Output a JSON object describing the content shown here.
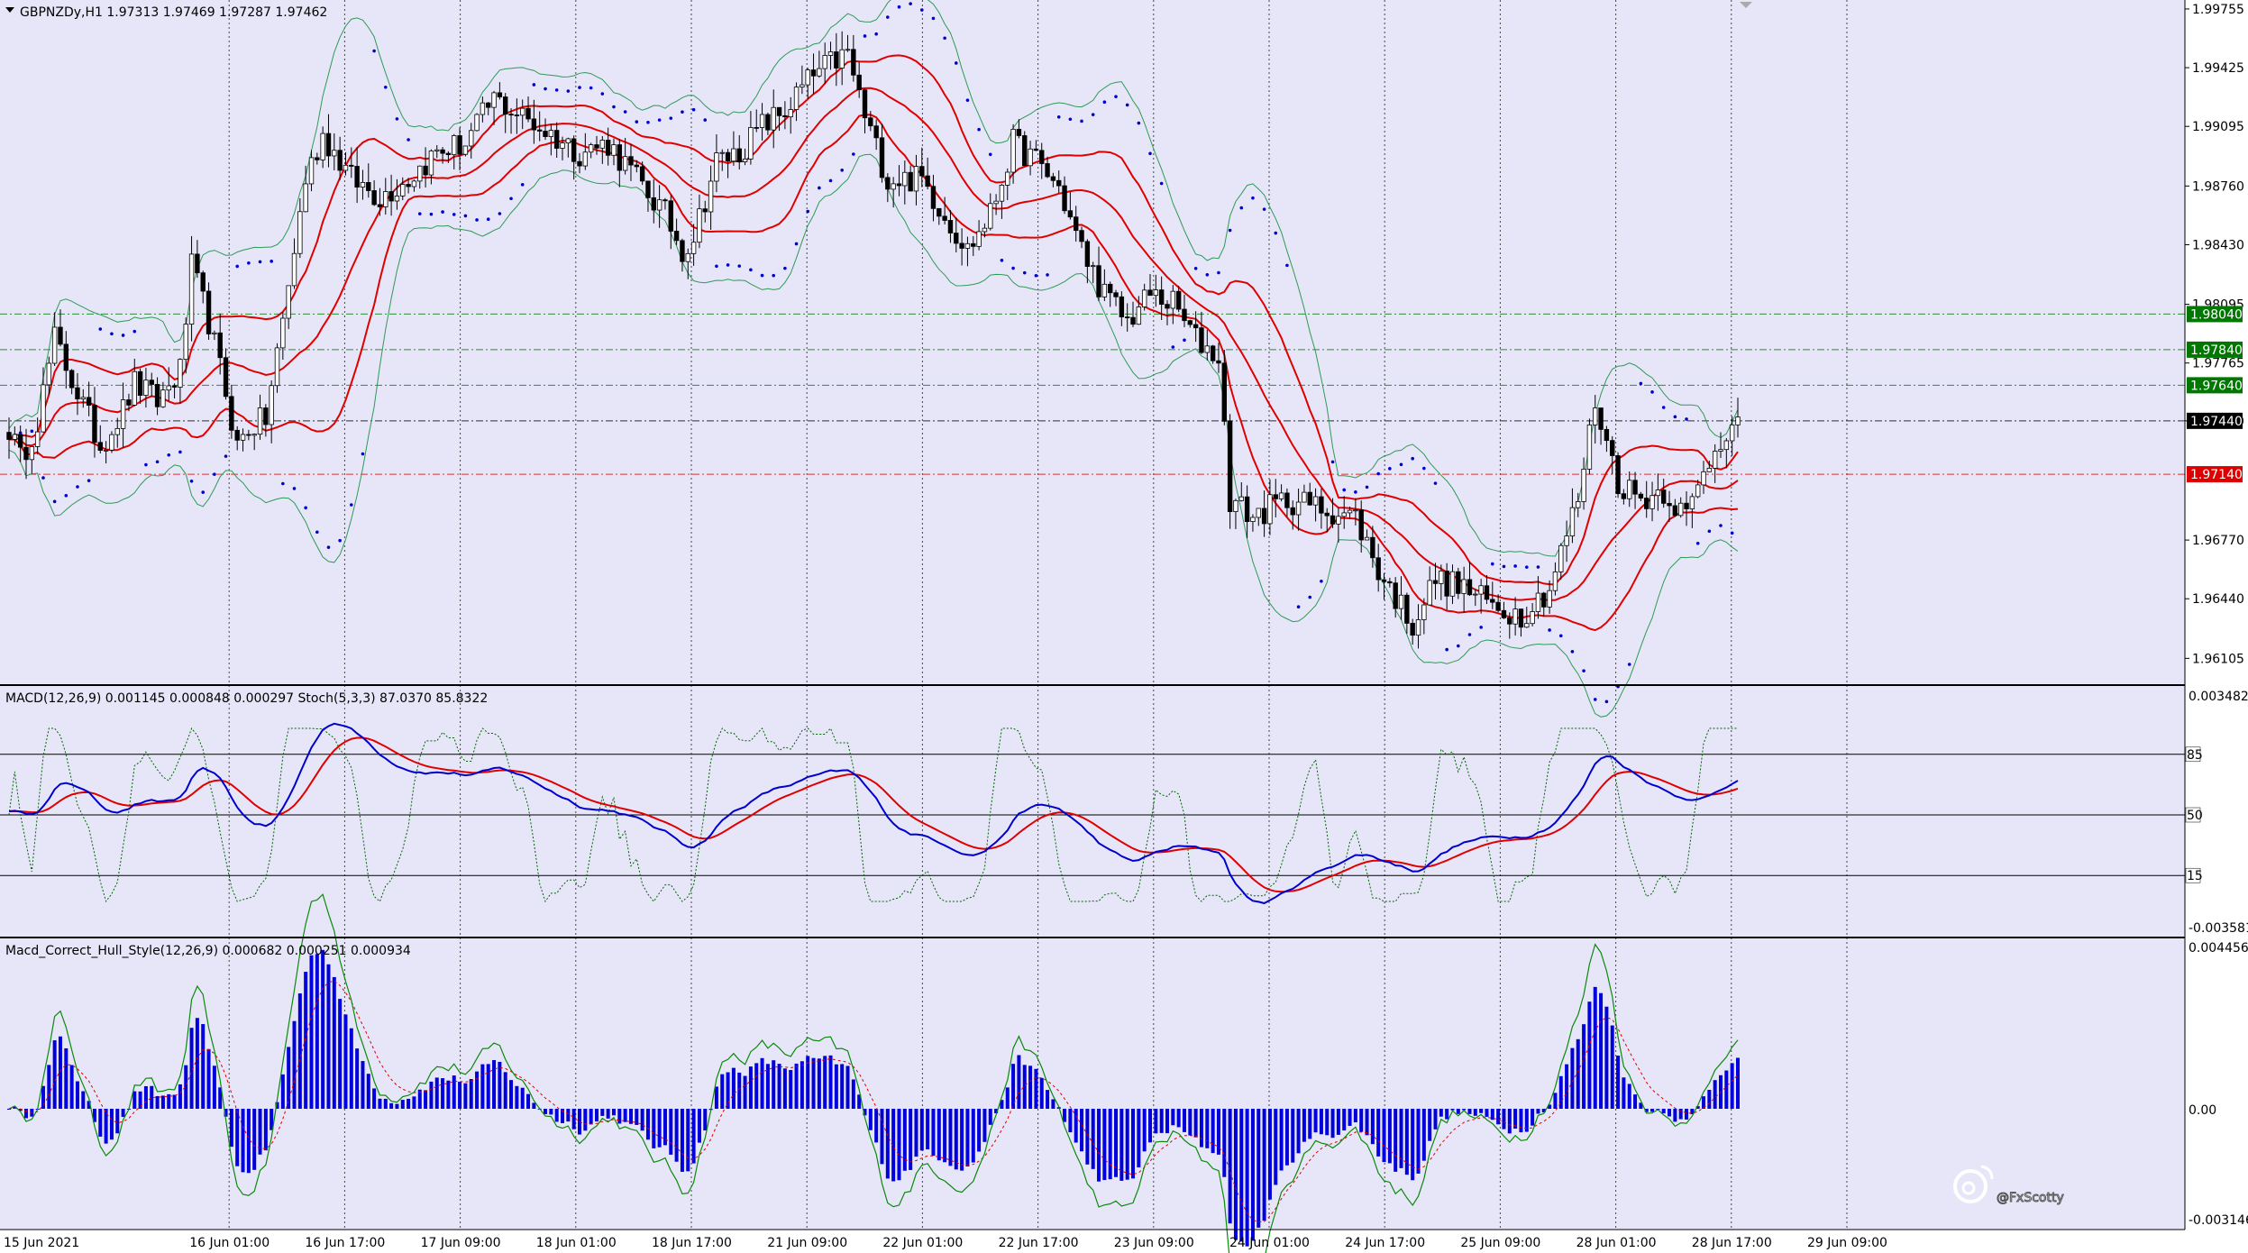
{
  "window": {
    "title": "GBPNZDy,H1  1.97313 1.97469 1.97287 1.97462",
    "background_color": "#e6e6f8"
  },
  "main_pane": {
    "price_levels": [
      "1.99755",
      "1.99425",
      "1.99095",
      "1.98760",
      "1.98430",
      "1.98095",
      "1.97765",
      "1.97440",
      "1.96770",
      "1.96440",
      "1.96105"
    ],
    "badges": [
      {
        "label": "1.98040",
        "value": 1.9804,
        "color": "#007700",
        "text_color": "#ffffff",
        "line": "dash-dot"
      },
      {
        "label": "1.97840",
        "value": 1.9784,
        "color": "#007700",
        "text_color": "#ffffff",
        "line": "dash-dot"
      },
      {
        "label": "1.97640",
        "value": 1.9764,
        "color": "#007700",
        "text_color": "#ffffff",
        "line": "dash-dot"
      },
      {
        "label": "1.97440",
        "value": 1.9744,
        "color": "#000000",
        "text_color": "#ffffff",
        "line": "dash-dot"
      },
      {
        "label": "1.97140",
        "value": 1.9714,
        "color": "#dd0000",
        "text_color": "#ffffff",
        "line": "dash-dot"
      }
    ],
    "ylim": [
      1.95975,
      1.99775
    ]
  },
  "macd_pane": {
    "label": "MACD(12,26,9) 0.001145 0.000848 0.000297  Stoch(5,3,3) 87.0370 85.8322",
    "scale_top": "0.003482",
    "scale_bottom": "-0.003581",
    "levels": [
      "85",
      "50",
      "15"
    ]
  },
  "hull_pane": {
    "label": "Macd_Correct_Hull_Style(12,26,9) 0.000682 0.000251 0.000934",
    "scale_top": "0.004456",
    "scale_mid": "0.00",
    "scale_bottom": "-0.003146"
  },
  "time_axis": [
    "15 Jun 2021",
    "16 Jun 01:00",
    "16 Jun 17:00",
    "17 Jun 09:00",
    "18 Jun 01:00",
    "18 Jun 17:00",
    "21 Jun 09:00",
    "22 Jun 01:00",
    "22 Jun 17:00",
    "23 Jun 09:00",
    "24 Jun 01:00",
    "24 Jun 17:00",
    "25 Jun 09:00",
    "28 Jun 01:00",
    "28 Jun 17:00",
    "29 Jun 09:00"
  ],
  "watermark": "@FxScotty",
  "colors": {
    "candle_up": "#ffffff",
    "candle_down": "#000000",
    "ma": "#e00000",
    "bands": "#2e9a55",
    "sar": "#0000cc",
    "macd_main": "#0000cc",
    "macd_signal": "#e00000",
    "stoch": "#006400",
    "hist": "#0000dd",
    "hull_signal": "#e00000",
    "hull_line": "#0a8a0a"
  },
  "chart_data": {
    "type": "candlestick",
    "symbol": "GBPNZDy",
    "timeframe": "H1",
    "last": {
      "open": 1.97313,
      "high": 1.97469,
      "low": 1.97287,
      "close": 1.97462
    },
    "close_path": [
      [
        0,
        1.974
      ],
      [
        2,
        1.9722
      ],
      [
        5,
        1.9745
      ],
      [
        8,
        1.979
      ],
      [
        12,
        1.976
      ],
      [
        16,
        1.973
      ],
      [
        20,
        1.975
      ],
      [
        22,
        1.9765
      ],
      [
        26,
        1.9755
      ],
      [
        30,
        1.9772
      ],
      [
        32,
        1.983
      ],
      [
        35,
        1.98
      ],
      [
        38,
        1.976
      ],
      [
        40,
        1.973
      ],
      [
        42,
        1.974
      ],
      [
        45,
        1.9745
      ],
      [
        48,
        1.98
      ],
      [
        52,
        1.988
      ],
      [
        55,
        1.9905
      ],
      [
        60,
        1.988
      ],
      [
        65,
        1.987
      ],
      [
        70,
        1.988
      ],
      [
        75,
        1.9895
      ],
      [
        80,
        1.99
      ],
      [
        85,
        1.9925
      ],
      [
        90,
        1.9915
      ],
      [
        95,
        1.9905
      ],
      [
        100,
        1.9895
      ],
      [
        105,
        1.99
      ],
      [
        110,
        1.988
      ],
      [
        115,
        1.986
      ],
      [
        118,
        1.984
      ],
      [
        120,
        1.9848
      ],
      [
        124,
        1.989
      ],
      [
        128,
        1.9895
      ],
      [
        132,
        1.991
      ],
      [
        136,
        1.9918
      ],
      [
        140,
        1.9935
      ],
      [
        144,
        1.9945
      ],
      [
        147,
        1.995
      ],
      [
        150,
        1.9915
      ],
      [
        154,
        1.988
      ],
      [
        160,
        1.988
      ],
      [
        164,
        1.986
      ],
      [
        168,
        1.984
      ],
      [
        172,
        1.986
      ],
      [
        176,
        1.99
      ],
      [
        180,
        1.989
      ],
      [
        184,
        1.9875
      ],
      [
        188,
        1.984
      ],
      [
        192,
        1.9815
      ],
      [
        196,
        1.98
      ],
      [
        200,
        1.9815
      ],
      [
        204,
        1.981
      ],
      [
        208,
        1.979
      ],
      [
        212,
        1.978
      ],
      [
        214,
        1.97
      ],
      [
        218,
        1.969
      ],
      [
        224,
        1.97
      ],
      [
        230,
        1.9695
      ],
      [
        236,
        1.969
      ],
      [
        240,
        1.966
      ],
      [
        244,
        1.964
      ],
      [
        246,
        1.963
      ],
      [
        250,
        1.9655
      ],
      [
        255,
        1.965
      ],
      [
        260,
        1.964
      ],
      [
        265,
        1.9635
      ],
      [
        270,
        1.965
      ],
      [
        275,
        1.97
      ],
      [
        278,
        1.9755
      ],
      [
        282,
        1.971
      ],
      [
        286,
        1.97
      ],
      [
        290,
        1.9705
      ],
      [
        294,
        1.969
      ],
      [
        298,
        1.9722
      ],
      [
        302,
        1.9746
      ]
    ]
  }
}
